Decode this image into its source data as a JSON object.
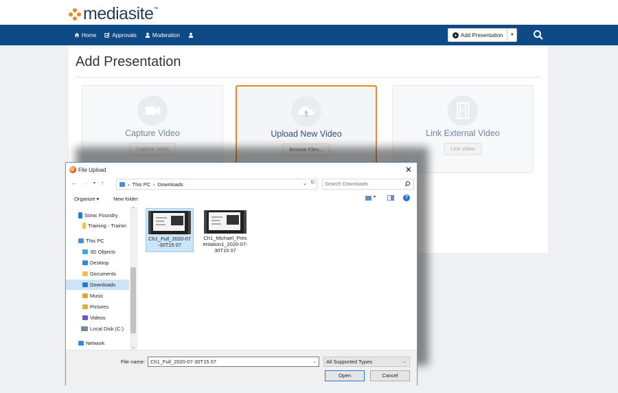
{
  "app": {
    "logo_text": "mediasite",
    "logo_mark": "™"
  },
  "nav": {
    "items": [
      {
        "label": "Home",
        "icon": "home-icon"
      },
      {
        "label": "Approvals",
        "icon": "approvals-icon"
      },
      {
        "label": "Moderation",
        "icon": "user-icon"
      },
      {
        "label": "",
        "icon": "user-icon"
      }
    ],
    "add_presentation_label": "Add Presentation"
  },
  "page": {
    "title": "Add Presentation",
    "options": [
      {
        "title": "Capture Video",
        "button": "Capture Video",
        "icon": "video-camera-icon"
      },
      {
        "title": "Upload New Video",
        "button": "Browse Files...",
        "icon": "cloud-upload-icon"
      },
      {
        "title": "Link External Video",
        "button": "Link Video",
        "icon": "film-icon"
      }
    ]
  },
  "dialog": {
    "title": "File Upload",
    "address": {
      "parts": [
        "This PC",
        "Downloads"
      ]
    },
    "search_placeholder": "Search Downloads",
    "toolbar": {
      "organize": "Organize ▾",
      "new_folder": "New folder"
    },
    "nav_items": [
      {
        "label": "Sonic Foundry",
        "icon": "onedrive-icon",
        "color": "#2a7bd6"
      },
      {
        "label": "Training - Trainin",
        "icon": "folder-icon",
        "color": "#f3c24d"
      },
      {
        "label": "This PC",
        "icon": "computer-icon",
        "color": "#4a8fd8"
      },
      {
        "label": "3D Objects",
        "icon": "3d-objects-icon",
        "color": "#3fa7e0"
      },
      {
        "label": "Desktop",
        "icon": "desktop-icon",
        "color": "#2f8bd8"
      },
      {
        "label": "Documents",
        "icon": "documents-icon",
        "color": "#f0c050"
      },
      {
        "label": "Downloads",
        "icon": "downloads-icon",
        "color": "#2a7bd6"
      },
      {
        "label": "Music",
        "icon": "music-icon",
        "color": "#f0a030"
      },
      {
        "label": "Pictures",
        "icon": "pictures-icon",
        "color": "#e0b040"
      },
      {
        "label": "Videos",
        "icon": "videos-icon",
        "color": "#6a5acd"
      },
      {
        "label": "Local Disk (C:)",
        "icon": "disk-icon",
        "color": "#7a8a9a"
      },
      {
        "label": "Network",
        "icon": "network-icon",
        "color": "#3a8ad8"
      }
    ],
    "files": [
      {
        "name": "Ch1_Full_2020-07-30T15 07"
      },
      {
        "name": "Ch1_Michael_Presentation1_2020-07-30T15 07"
      }
    ],
    "file_name_label": "File name:",
    "file_name_value": "Ch1_Full_2020-07-30T15 07",
    "file_type": "All Supported Types",
    "open_label": "Open",
    "cancel_label": "Cancel"
  },
  "colors": {
    "nav_bg": "#0d4a86",
    "accent": "#e8891e",
    "logo_orange": "#f0871d"
  }
}
